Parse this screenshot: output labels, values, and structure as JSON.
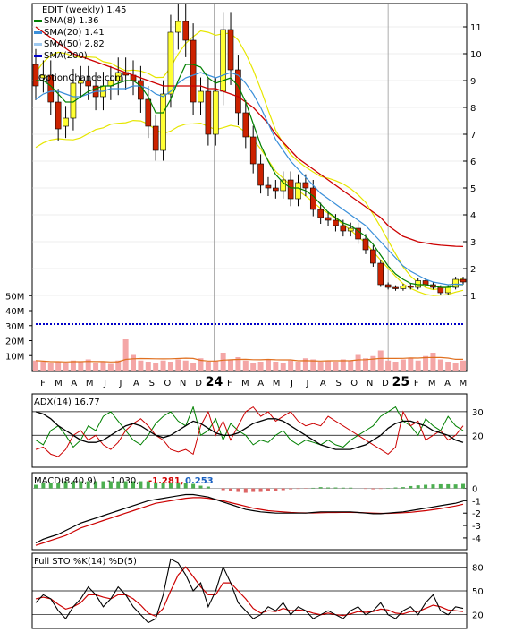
{
  "chart_data": {
    "type": "line",
    "ticker_label": "EDIT (weekly) 1.45",
    "watermark": "OptionChance.com",
    "legend": [
      {
        "label": "SMA(8) 1.36",
        "color": "#008000"
      },
      {
        "label": "SMA(20) 1.41",
        "color": "#3a8fd9"
      },
      {
        "label": "SMA(50) 2.82",
        "color": "#9ec9f0"
      },
      {
        "label": "SMA(200)",
        "color": "#0000c8"
      }
    ],
    "x_labels": [
      "F",
      "M",
      "A",
      "M",
      "J",
      "J",
      "A",
      "S",
      "O",
      "N",
      "D",
      "24",
      "F",
      "M",
      "A",
      "M",
      "J",
      "J",
      "A",
      "S",
      "O",
      "N",
      "D",
      "25",
      "F",
      "M",
      "A",
      "M"
    ],
    "price_axis": {
      "ticks": [
        1,
        2,
        3,
        4,
        5,
        6,
        7,
        8,
        9,
        10,
        11
      ],
      "range": [
        0,
        12
      ]
    },
    "volume_axis": {
      "ticks": [
        "10M",
        "20M",
        "30M",
        "40M",
        "50M"
      ]
    },
    "price": {
      "close": [
        8.8,
        9.2,
        8.2,
        7.2,
        7.6,
        8.9,
        9.0,
        8.8,
        8.4,
        8.8,
        9.0,
        9.3,
        9.2,
        9.0,
        8.3,
        7.3,
        6.4,
        8.5,
        10.8,
        11.2,
        10.5,
        8.2,
        8.6,
        7.0,
        8.6,
        10.9,
        9.4,
        7.8,
        6.9,
        5.9,
        5.1,
        5.0,
        4.9,
        5.3,
        4.6,
        5.2,
        5.0,
        4.2,
        3.9,
        3.8,
        3.6,
        3.4,
        3.5,
        3.1,
        2.7,
        2.2,
        1.4,
        1.3,
        1.25,
        1.35,
        1.3,
        1.55,
        1.4,
        1.3,
        1.1,
        1.3,
        1.6,
        1.5
      ],
      "open": [
        9.6,
        9.1,
        9.2,
        8.2,
        7.3,
        7.6,
        8.9,
        9.0,
        8.8,
        8.4,
        8.8,
        9.0,
        9.3,
        9.2,
        9.0,
        8.3,
        7.3,
        6.4,
        8.5,
        10.8,
        11.2,
        10.5,
        8.2,
        8.6,
        7.0,
        8.6,
        10.9,
        9.4,
        7.8,
        6.9,
        5.9,
        5.1,
        5.0,
        4.9,
        5.3,
        4.6,
        5.2,
        5.0,
        4.2,
        3.9,
        3.8,
        3.6,
        3.4,
        3.5,
        3.1,
        2.7,
        2.2,
        1.4,
        1.3,
        1.25,
        1.35,
        1.3,
        1.55,
        1.4,
        1.3,
        1.1,
        1.3,
        1.6
      ],
      "sma8": [
        9.0,
        9.0,
        8.8,
        8.5,
        8.2,
        8.2,
        8.4,
        8.6,
        8.7,
        8.8,
        8.8,
        8.9,
        9.0,
        9.0,
        8.8,
        8.4,
        7.8,
        7.8,
        8.3,
        9.0,
        9.6,
        9.6,
        9.5,
        9.1,
        8.9,
        9.0,
        9.1,
        8.8,
        8.2,
        7.4,
        6.6,
        6.0,
        5.5,
        5.2,
        5.0,
        5.0,
        4.9,
        4.7,
        4.4,
        4.1,
        3.9,
        3.7,
        3.6,
        3.4,
        3.2,
        2.9,
        2.5,
        2.1,
        1.8,
        1.6,
        1.45,
        1.4,
        1.4,
        1.35,
        1.3,
        1.3,
        1.35,
        1.36
      ],
      "sma20": [
        8.3,
        8.5,
        8.6,
        8.6,
        8.5,
        8.4,
        8.4,
        8.5,
        8.6,
        8.6,
        8.7,
        8.7,
        8.7,
        8.8,
        8.8,
        8.7,
        8.5,
        8.4,
        8.6,
        8.9,
        9.1,
        9.2,
        9.3,
        9.2,
        9.1,
        9.2,
        9.3,
        9.2,
        8.9,
        8.5,
        8.0,
        7.4,
        6.8,
        6.4,
        6.0,
        5.7,
        5.4,
        5.1,
        4.8,
        4.6,
        4.4,
        4.2,
        4.0,
        3.8,
        3.6,
        3.3,
        3.0,
        2.7,
        2.4,
        2.1,
        1.9,
        1.75,
        1.6,
        1.5,
        1.45,
        1.4,
        1.42,
        1.41
      ],
      "sma50": [
        11.0,
        10.8,
        10.6,
        10.4,
        10.2,
        10.0,
        9.9,
        9.8,
        9.7,
        9.6,
        9.5,
        9.4,
        9.3,
        9.2,
        9.1,
        9.0,
        8.9,
        8.8,
        8.8,
        8.8,
        8.8,
        8.8,
        8.8,
        8.7,
        8.7,
        8.6,
        8.5,
        8.4,
        8.2,
        8.0,
        7.7,
        7.4,
        7.0,
        6.7,
        6.4,
        6.1,
        5.9,
        5.7,
        5.5,
        5.3,
        5.1,
        4.9,
        4.7,
        4.5,
        4.3,
        4.1,
        3.9,
        3.6,
        3.4,
        3.2,
        3.1,
        3.0,
        2.95,
        2.9,
        2.87,
        2.85,
        2.83,
        2.82
      ]
    },
    "volume_millions": [
      9,
      8,
      7,
      8,
      7,
      9,
      8,
      10,
      7,
      8,
      6,
      9,
      28,
      14,
      9,
      8,
      7,
      9,
      8,
      10,
      9,
      7,
      11,
      8,
      9,
      16,
      10,
      12,
      9,
      7,
      8,
      10,
      8,
      7,
      9,
      8,
      11,
      10,
      8,
      9,
      8,
      10,
      9,
      14,
      11,
      13,
      18,
      9,
      8,
      10,
      11,
      9,
      13,
      16,
      10,
      8,
      7,
      9
    ],
    "adx": {
      "label": "ADX(14) 16.77",
      "ticks": [
        20,
        30
      ],
      "adx": [
        30,
        29,
        27,
        24,
        22,
        20,
        18,
        17,
        17,
        18,
        20,
        22,
        24,
        25,
        24,
        22,
        20,
        19,
        20,
        22,
        24,
        26,
        25,
        23,
        21,
        20,
        20,
        21,
        23,
        25,
        26,
        27,
        27,
        26,
        24,
        22,
        20,
        18,
        16,
        15,
        14,
        14,
        14,
        15,
        16,
        18,
        20,
        23,
        25,
        26,
        26,
        25,
        24,
        22,
        21,
        20,
        18,
        17
      ],
      "plus_di": [
        18,
        16,
        22,
        24,
        20,
        15,
        18,
        24,
        22,
        28,
        30,
        26,
        22,
        18,
        16,
        20,
        25,
        28,
        30,
        26,
        24,
        32,
        20,
        22,
        27,
        18,
        25,
        22,
        20,
        16,
        18,
        17,
        20,
        22,
        18,
        16,
        18,
        17,
        16,
        18,
        16,
        15,
        18,
        20,
        22,
        24,
        28,
        30,
        32,
        26,
        24,
        20,
        27,
        24,
        22,
        28,
        24,
        22
      ],
      "minus_di": [
        14,
        15,
        12,
        11,
        14,
        20,
        22,
        18,
        20,
        16,
        14,
        17,
        22,
        25,
        27,
        24,
        20,
        18,
        14,
        13,
        14,
        12,
        24,
        30,
        20,
        26,
        18,
        24,
        30,
        32,
        28,
        30,
        26,
        28,
        30,
        26,
        24,
        25,
        24,
        28,
        26,
        24,
        22,
        20,
        18,
        16,
        14,
        12,
        15,
        30,
        24,
        26,
        18,
        20,
        22,
        18,
        20,
        24
      ]
    },
    "macd": {
      "label": "MACD(8,40,9)",
      "values_label": "-1.030,",
      "macd_label": "-1.281,",
      "signal_label": "0.253",
      "ticks": [
        0,
        -1,
        -2,
        -3,
        -4
      ],
      "macd": [
        -4.4,
        -4.1,
        -3.9,
        -3.7,
        -3.4,
        -3.1,
        -2.8,
        -2.6,
        -2.4,
        -2.2,
        -2.0,
        -1.8,
        -1.6,
        -1.4,
        -1.2,
        -1.0,
        -0.9,
        -0.8,
        -0.7,
        -0.6,
        -0.5,
        -0.5,
        -0.6,
        -0.7,
        -0.9,
        -1.1,
        -1.3,
        -1.5,
        -1.7,
        -1.8,
        -1.9,
        -1.95,
        -2.0,
        -2.0,
        -2.0,
        -2.0,
        -2.0,
        -1.95,
        -1.9,
        -1.9,
        -1.9,
        -1.9,
        -1.9,
        -1.95,
        -2.0,
        -2.05,
        -2.05,
        -2.0,
        -1.95,
        -1.9,
        -1.8,
        -1.7,
        -1.6,
        -1.5,
        -1.4,
        -1.3,
        -1.2,
        -1.03
      ],
      "signal": [
        -4.6,
        -4.4,
        -4.2,
        -4.0,
        -3.8,
        -3.5,
        -3.2,
        -3.0,
        -2.8,
        -2.6,
        -2.4,
        -2.2,
        -2.0,
        -1.8,
        -1.6,
        -1.4,
        -1.2,
        -1.1,
        -1.0,
        -0.9,
        -0.8,
        -0.75,
        -0.75,
        -0.8,
        -0.9,
        -1.0,
        -1.15,
        -1.3,
        -1.45,
        -1.6,
        -1.7,
        -1.8,
        -1.85,
        -1.9,
        -1.95,
        -1.97,
        -1.98,
        -1.98,
        -1.97,
        -1.95,
        -1.95,
        -1.94,
        -1.94,
        -1.95,
        -1.97,
        -2.0,
        -2.02,
        -2.02,
        -2.0,
        -1.97,
        -1.93,
        -1.87,
        -1.8,
        -1.72,
        -1.63,
        -1.53,
        -1.42,
        -1.28
      ]
    },
    "stochastic": {
      "label": "Full STO %K(14) %D(5)",
      "ticks": [
        80,
        50,
        20
      ],
      "k": [
        35,
        45,
        40,
        25,
        15,
        30,
        40,
        55,
        45,
        30,
        40,
        55,
        45,
        30,
        20,
        10,
        15,
        45,
        90,
        85,
        70,
        50,
        60,
        30,
        50,
        80,
        60,
        35,
        25,
        15,
        20,
        30,
        25,
        35,
        20,
        30,
        25,
        15,
        20,
        25,
        20,
        15,
        25,
        30,
        20,
        25,
        35,
        20,
        15,
        25,
        30,
        20,
        35,
        45,
        25,
        20,
        30,
        28
      ],
      "d": [
        40,
        42,
        40,
        33,
        27,
        30,
        35,
        45,
        45,
        42,
        40,
        45,
        45,
        40,
        32,
        22,
        18,
        28,
        50,
        70,
        80,
        68,
        55,
        45,
        45,
        60,
        60,
        50,
        40,
        28,
        22,
        25,
        24,
        28,
        25,
        26,
        25,
        22,
        20,
        22,
        20,
        19,
        21,
        24,
        23,
        24,
        27,
        26,
        22,
        21,
        24,
        24,
        28,
        32,
        30,
        26,
        25,
        24
      ]
    }
  },
  "colors": {
    "up": "#ffff33",
    "down": "#cc2200",
    "sma8": "#008000",
    "sma20": "#3a8fd9",
    "sma50": "#cc0000",
    "bband": "#e6e600",
    "volume": "#f4a6a6",
    "volume_ma": "#e07020",
    "sma200": "#0000c8",
    "grid": "#000000"
  }
}
